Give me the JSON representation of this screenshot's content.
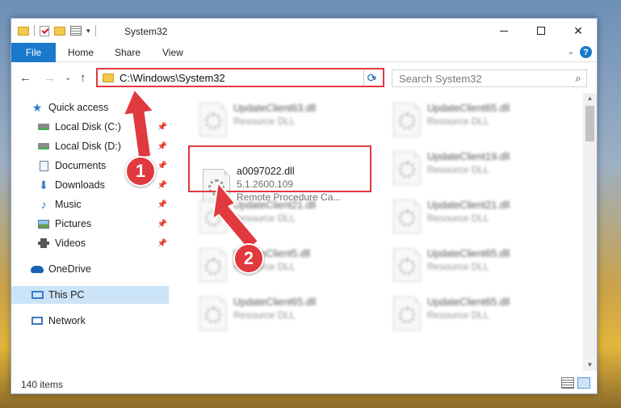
{
  "window": {
    "title": "System32",
    "controls": {
      "minimize": "–",
      "maximize": "",
      "close": "✕"
    }
  },
  "ribbon": {
    "file": "File",
    "tabs": [
      "Home",
      "Share",
      "View"
    ],
    "help": "?"
  },
  "address": {
    "path": "C:\\Windows\\System32",
    "search_placeholder": "Search System32"
  },
  "nav": {
    "items": [
      {
        "label": "Quick access",
        "icon": "star-icon",
        "pinned": false
      },
      {
        "label": "Local Disk (C:)",
        "icon": "disk-icon",
        "pinned": true
      },
      {
        "label": "Local Disk (D:)",
        "icon": "disk-icon",
        "pinned": true
      },
      {
        "label": "Documents",
        "icon": "documents-icon",
        "pinned": true
      },
      {
        "label": "Downloads",
        "icon": "downloads-icon",
        "pinned": true
      },
      {
        "label": "Music",
        "icon": "music-icon",
        "pinned": true
      },
      {
        "label": "Pictures",
        "icon": "pictures-icon",
        "pinned": true
      },
      {
        "label": "Videos",
        "icon": "videos-icon",
        "pinned": true
      },
      {
        "label": "OneDrive",
        "icon": "onedrive-icon",
        "pinned": false
      },
      {
        "label": "This PC",
        "icon": "this-pc-icon",
        "pinned": false,
        "selected": true
      },
      {
        "label": "Network",
        "icon": "network-icon",
        "pinned": false
      }
    ]
  },
  "files": [
    {
      "name": "UpdateClient63.dll",
      "type": "Resource DLL",
      "blurred": true
    },
    {
      "name": "UpdateClient65.dll",
      "type": "Resource DLL",
      "blurred": true
    },
    {
      "name": "a0097022.dll",
      "version": "5.1.2600.109",
      "type": "Remote Procedure Ca...",
      "blurred": false,
      "highlighted": true
    },
    {
      "name": "UpdateClient19.dll",
      "type": "Resource DLL",
      "blurred": true
    },
    {
      "name": "UpdateClient21.dll",
      "type": "Resource DLL",
      "blurred": true
    },
    {
      "name": "UpdateClient21.dll",
      "type": "Resource DLL",
      "blurred": true
    },
    {
      "name": "UpdateClient5.dll",
      "type": "Resource DLL",
      "blurred": true
    },
    {
      "name": "UpdateClient65.dll",
      "type": "Resource DLL",
      "blurred": true
    },
    {
      "name": "UpdateClient65.dll",
      "type": "Resource DLL",
      "blurred": true
    },
    {
      "name": "UpdateClient65.dll",
      "type": "Resource DLL",
      "blurred": true
    }
  ],
  "status": {
    "item_count": "140 items"
  },
  "annotations": {
    "step1": "1",
    "step2": "2"
  },
  "colors": {
    "accent": "#1979ca",
    "highlight": "#e0393e",
    "selected_bg": "#cce4f7"
  }
}
